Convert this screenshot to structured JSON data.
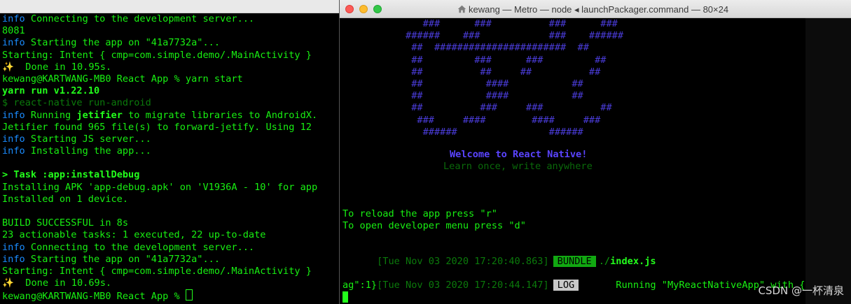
{
  "left_terminal": {
    "lines": [
      {
        "kind": "info",
        "tag": "info",
        "text": " Connecting to the development server..."
      },
      {
        "kind": "plain",
        "text": "8081"
      },
      {
        "kind": "info",
        "tag": "info",
        "text": " Starting the app on \"41a7732a\"..."
      },
      {
        "kind": "plain",
        "text": "Starting: Intent { cmp=com.simple.demo/.MainActivity }"
      },
      {
        "kind": "done",
        "icon": "✨",
        "text": "  Done in 10.95s."
      },
      {
        "kind": "plain",
        "text": "kewang@KARTWANG-MB0 React App % yarn start"
      },
      {
        "kind": "bold",
        "text": "yarn run v1.22.10"
      },
      {
        "kind": "dim",
        "text": "$ react-native run-android"
      },
      {
        "kind": "jetifier",
        "tag": "info",
        "pre": " Running ",
        "strong": "jetifier",
        "post": " to migrate libraries to AndroidX."
      },
      {
        "kind": "plain",
        "text": "Jetifier found 965 file(s) to forward-jetify. Using 12"
      },
      {
        "kind": "info",
        "tag": "info",
        "text": " Starting JS server..."
      },
      {
        "kind": "info",
        "tag": "info",
        "text": " Installing the app..."
      },
      {
        "kind": "blank",
        "text": ""
      },
      {
        "kind": "task",
        "prefix": "> ",
        "text": "Task :app:installDebug"
      },
      {
        "kind": "plain",
        "text": "Installing APK 'app-debug.apk' on 'V1936A - 10' for app"
      },
      {
        "kind": "plain",
        "text": "Installed on 1 device."
      },
      {
        "kind": "blank",
        "text": ""
      },
      {
        "kind": "plain",
        "text": "BUILD SUCCESSFUL in 8s"
      },
      {
        "kind": "plain",
        "text": "23 actionable tasks: 1 executed, 22 up-to-date"
      },
      {
        "kind": "info",
        "tag": "info",
        "text": " Connecting to the development server..."
      },
      {
        "kind": "info",
        "tag": "info",
        "text": " Starting the app on \"41a7732a\"..."
      },
      {
        "kind": "plain",
        "text": "Starting: Intent { cmp=com.simple.demo/.MainActivity }"
      },
      {
        "kind": "done",
        "icon": "✨",
        "text": "  Done in 10.69s."
      },
      {
        "kind": "prompt",
        "text": "kewang@KARTWANG-MB0 React App % "
      }
    ]
  },
  "right_window": {
    "title": "kewang — Metro — node ◂ launchPackager.command — 80×24",
    "icon": "home-folder-icon",
    "ascii_art": [
      "              ###      ###          ###      ###",
      "           ######    ###            ###    ######",
      "            ##  #######################  ##",
      "            ##         ###      ###         ##",
      "            ##          ##     ##          ##",
      "            ##           ####           ##",
      "            ##           ####           ##",
      "            ##          ###     ###          ##",
      "             ###     ####        ####     ###",
      "              ######                ######"
    ],
    "welcome": "Welcome to React Native!",
    "tagline": "Learn once, write anywhere",
    "reload_line": "To reload the app press \"r\"",
    "devmenu_line": "To open developer menu press \"d\"",
    "bundle_log": {
      "timestamp": "[Tue Nov 03 2020 17:20:40.863]",
      "badge": "BUNDLE",
      "path": "./",
      "file": "index.js"
    },
    "app_log": {
      "timestamp": "[Tue Nov 03 2020 17:20:44.147]",
      "badge": "LOG",
      "message_line1": "      Running \"MyReactNativeApp\" with {\"rootT",
      "message_line2": "ag\":1}"
    }
  },
  "watermark": "CSDN @一杯清泉",
  "colors": {
    "terminal_green": "#18f012",
    "info_blue": "#1a8cff",
    "ascii_purple": "#4a3cd9",
    "bundle_badge": "#11a811",
    "log_badge": "#c9c9c9"
  }
}
